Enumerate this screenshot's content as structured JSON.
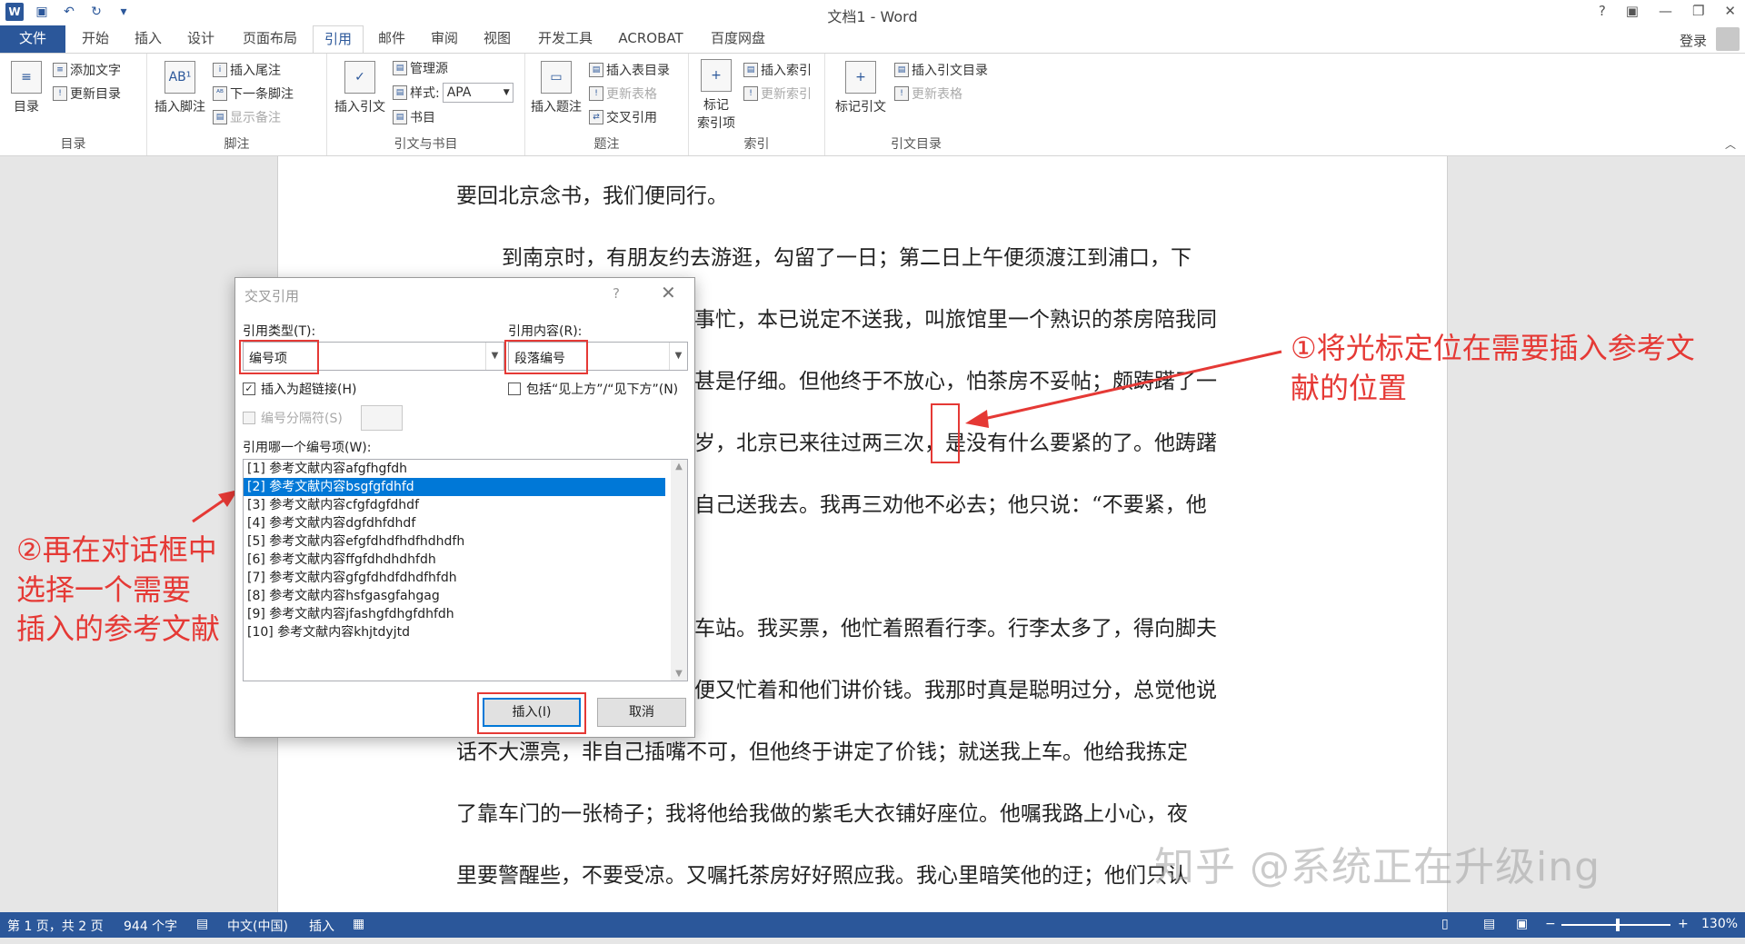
{
  "window": {
    "title": "文档1 - Word",
    "controls": [
      "?",
      "▣",
      "—",
      "❐",
      "✕"
    ],
    "login": "登录"
  },
  "ribbon_tabs": [
    "文件",
    "开始",
    "插入",
    "设计",
    "页面布局",
    "引用",
    "邮件",
    "审阅",
    "视图",
    "开发工具",
    "ACROBAT",
    "百度网盘"
  ],
  "ribbon": {
    "toc": {
      "big": "目录",
      "add_text": "添加文字",
      "update": "更新目录",
      "label": "目录"
    },
    "footnote": {
      "insert_footnote": "插入脚注",
      "insert_endnote": "插入尾注",
      "next_footnote": "下一条脚注",
      "show_notes": "显示备注",
      "label": "脚注"
    },
    "citation": {
      "insert_citation": "插入引文",
      "manage_sources": "管理源",
      "style_label": "样式:",
      "style_value": "APA",
      "bibliography": "书目",
      "label": "引文与书目"
    },
    "caption": {
      "insert_caption": "插入题注",
      "insert_table_of_figures": "插入表目录",
      "update_table": "更新表格",
      "cross_reference": "交叉引用",
      "label": "题注"
    },
    "index": {
      "mark_entry": "标记",
      "mark_entry2": "索引项",
      "insert_index": "插入索引",
      "update_index": "更新索引",
      "label": "索引"
    },
    "authorities": {
      "mark_citation": "标记引文",
      "insert_toa": "插入引文目录",
      "update_table": "更新表格",
      "label": "引文目录"
    }
  },
  "document_lines": [
    "要回北京念书，我们便同行。",
    "到南京时，有朋友约去游逛，勾留了一日；第二日上午便须渡江到浦口，下",
    "事忙，本已说定不送我，叫旅馆里一个熟识的茶房陪我同",
    "甚是仔细。但他终于不放心，怕茶房不妥帖；颇踌躇了一",
    "岁，北京已来往过两三次，是没有什么要紧的了。他踌躇",
    "自己送我去。我再三劝他不必去；他只说：“不要紧，他",
    "车站。我买票，他忙着照看行李。行李太多了，得向脚夫",
    "便又忙着和他们讲价钱。我那时真是聪明过分，总觉他说",
    "话不大漂亮，非自己插嘴不可，但他终于讲定了价钱；就送我上车。他给我拣定",
    "了靠车门的一张椅子；我将他给我做的紫毛大衣铺好座位。他嘱我路上小心，夜",
    "里要警醒些，不要受凉。又嘱托茶房好好照应我。我心里暗笑他的迂；他们只认"
  ],
  "dialog": {
    "title": "交叉引用",
    "help": "?",
    "ref_type_label": "引用类型(T):",
    "ref_type_value": "编号项",
    "ref_content_label": "引用内容(R):",
    "ref_content_value": "段落编号",
    "hyperlink_label": "插入为超链接(H)",
    "hyperlink_checked": true,
    "above_below_label": "包括“见上方”/“见下方”(N)",
    "above_below_checked": false,
    "separator_label": "编号分隔符(S)",
    "list_label": "引用哪一个编号项(W):",
    "items": [
      "[1] 参考文献内容afgfhgfdh",
      "[2] 参考文献内容bsgfgfdhfd",
      "[3] 参考文献内容cfgfdgfdhdf",
      "[4] 参考文献内容dgfdhfdhdf",
      "[5] 参考文献内容efgfdhdfhdfhdhdfh",
      "[6] 参考文献内容ffgfdhdhdhfdh",
      "[7] 参考文献内容gfgfdhdfdhdfhfdh",
      "[8] 参考文献内容hsfgasgfahgag",
      "[9] 参考文献内容jfashgfdhgfdhfdh",
      "[10] 参考文献内容khjtdyjtd"
    ],
    "selected_index": 1,
    "insert_button": "插入(I)",
    "cancel_button": "取消"
  },
  "annotations": {
    "step1_line1": "①将光标定位在需要插入参考文",
    "step1_line2": "献的位置",
    "step2_line1": "②再在对话框中",
    "step2_line2": "选择一个需要",
    "step2_line3": "插入的参考文献",
    "color": "#e53935"
  },
  "watermark": "知乎 @系统正在升级ing",
  "status_bar": {
    "page": "第 1 页，共 2 页",
    "words": "944 个字",
    "language": "中文(中国)",
    "mode": "插入",
    "zoom": "130%"
  },
  "colors": {
    "accent": "#2b579a",
    "selection": "#0078d7",
    "annotation": "#e53935"
  }
}
